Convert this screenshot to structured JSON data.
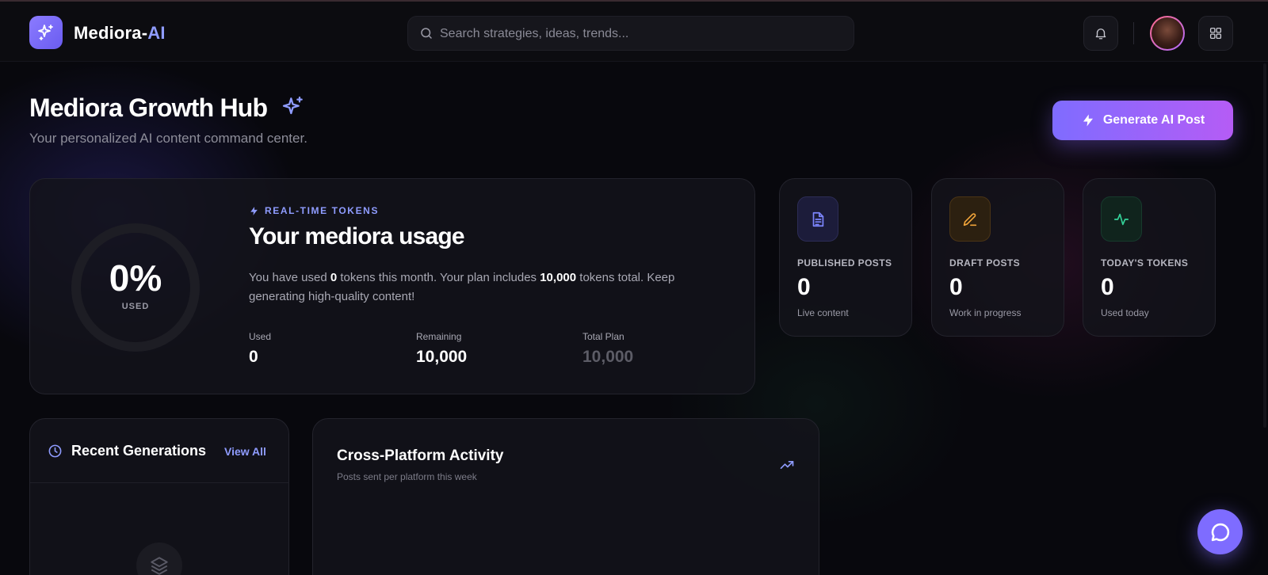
{
  "app": {
    "brand_main": "Mediora-",
    "brand_accent": "AI"
  },
  "header": {
    "search_placeholder": "Search strategies, ideas, trends..."
  },
  "page": {
    "title": "Mediora Growth Hub",
    "subtitle": "Your personalized AI content command center.",
    "generate_button": "Generate AI Post"
  },
  "usage": {
    "percent_used": 0,
    "percent_text": "0%",
    "ring_label": "USED",
    "section_label": "REAL-TIME TOKENS",
    "title": "Your mediora usage",
    "desc_before": "You have used ",
    "desc_used": "0",
    "desc_middle": " tokens this month. Your plan includes ",
    "desc_total": "10,000",
    "desc_after": " tokens total. Keep generating high-quality content!",
    "stats": [
      {
        "label": "Used",
        "value": "0"
      },
      {
        "label": "Remaining",
        "value": "10,000"
      },
      {
        "label": "Total Plan",
        "value": "10,000"
      }
    ]
  },
  "summary_cards": [
    {
      "label": "PUBLISHED POSTS",
      "value": "0",
      "sub": "Live content",
      "icon": "document-icon",
      "color": "#7d86ff"
    },
    {
      "label": "DRAFT POSTS",
      "value": "0",
      "sub": "Work in progress",
      "icon": "pencil-icon",
      "color": "#f0a43a"
    },
    {
      "label": "TODAY'S TOKENS",
      "value": "0",
      "sub": "Used today",
      "icon": "activity-icon",
      "color": "#34d399"
    }
  ],
  "recent": {
    "title": "Recent Generations",
    "view_all": "View All"
  },
  "activity": {
    "title": "Cross-Platform Activity",
    "subtitle": "Posts sent per platform this week"
  },
  "colors": {
    "accent": "#8f9cff",
    "brand_gradient_start": "#7f6cff",
    "brand_gradient_end": "#b55cf5"
  }
}
